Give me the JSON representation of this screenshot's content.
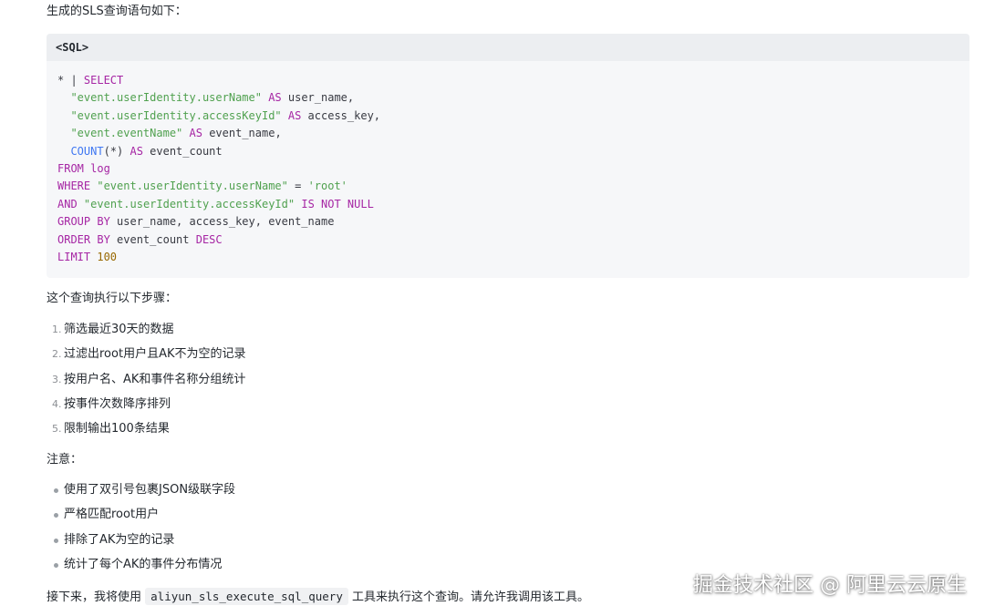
{
  "intro": "生成的SLS查询语句如下：",
  "code_block": {
    "header": "<SQL>",
    "lines": [
      [
        {
          "t": "* | ",
          "c": ""
        },
        {
          "t": "SELECT",
          "c": "kw"
        }
      ],
      [
        {
          "t": "  ",
          "c": ""
        },
        {
          "t": "\"event.userIdentity.userName\"",
          "c": "str"
        },
        {
          "t": " ",
          "c": ""
        },
        {
          "t": "AS",
          "c": "kw"
        },
        {
          "t": " user_name,",
          "c": ""
        }
      ],
      [
        {
          "t": "  ",
          "c": ""
        },
        {
          "t": "\"event.userIdentity.accessKeyId\"",
          "c": "str"
        },
        {
          "t": " ",
          "c": ""
        },
        {
          "t": "AS",
          "c": "kw"
        },
        {
          "t": " access_key,",
          "c": ""
        }
      ],
      [
        {
          "t": "  ",
          "c": ""
        },
        {
          "t": "\"event.eventName\"",
          "c": "str"
        },
        {
          "t": " ",
          "c": ""
        },
        {
          "t": "AS",
          "c": "kw"
        },
        {
          "t": " event_name,",
          "c": ""
        }
      ],
      [
        {
          "t": "  ",
          "c": ""
        },
        {
          "t": "COUNT",
          "c": "fn"
        },
        {
          "t": "(*) ",
          "c": ""
        },
        {
          "t": "AS",
          "c": "kw"
        },
        {
          "t": " event_count",
          "c": ""
        }
      ],
      [
        {
          "t": "FROM",
          "c": "kw"
        },
        {
          "t": " ",
          "c": ""
        },
        {
          "t": "log",
          "c": "kw"
        }
      ],
      [
        {
          "t": "WHERE",
          "c": "kw"
        },
        {
          "t": " ",
          "c": ""
        },
        {
          "t": "\"event.userIdentity.userName\"",
          "c": "str"
        },
        {
          "t": " = ",
          "c": ""
        },
        {
          "t": "'root'",
          "c": "str"
        }
      ],
      [
        {
          "t": "AND",
          "c": "kw"
        },
        {
          "t": " ",
          "c": ""
        },
        {
          "t": "\"event.userIdentity.accessKeyId\"",
          "c": "str"
        },
        {
          "t": " ",
          "c": ""
        },
        {
          "t": "IS NOT NULL",
          "c": "kw"
        }
      ],
      [
        {
          "t": "GROUP BY",
          "c": "kw"
        },
        {
          "t": " user_name, access_key, event_name",
          "c": ""
        }
      ],
      [
        {
          "t": "ORDER BY",
          "c": "kw"
        },
        {
          "t": " event_count ",
          "c": ""
        },
        {
          "t": "DESC",
          "c": "kw"
        }
      ],
      [
        {
          "t": "LIMIT",
          "c": "kw"
        },
        {
          "t": " ",
          "c": ""
        },
        {
          "t": "100",
          "c": "num"
        }
      ]
    ]
  },
  "steps_intro": "这个查询执行以下步骤：",
  "steps": [
    {
      "marker": "1.",
      "text": "筛选最近30天的数据"
    },
    {
      "marker": "2.",
      "text": "过滤出root用户且AK不为空的记录"
    },
    {
      "marker": "3.",
      "text": "按用户名、AK和事件名称分组统计"
    },
    {
      "marker": "4.",
      "text": "按事件次数降序排列"
    },
    {
      "marker": "5.",
      "text": "限制输出100条结果"
    }
  ],
  "note_label": "注意：",
  "notes": [
    "使用了双引号包裹JSON级联字段",
    "严格匹配root用户",
    "排除了AK为空的记录",
    "统计了每个AK的事件分布情况"
  ],
  "outro": {
    "before": "接下来，我将使用 ",
    "code": "aliyun_sls_execute_sql_query",
    "after": " 工具来执行这个查询。请允许我调用该工具。"
  },
  "watermark": "掘金技术社区 @ 阿里云云原生",
  "colors": {
    "keyword": "#a626a4",
    "string": "#50a14f",
    "function": "#4078f2",
    "number": "#986801",
    "code_background": "#f6f7f9"
  }
}
